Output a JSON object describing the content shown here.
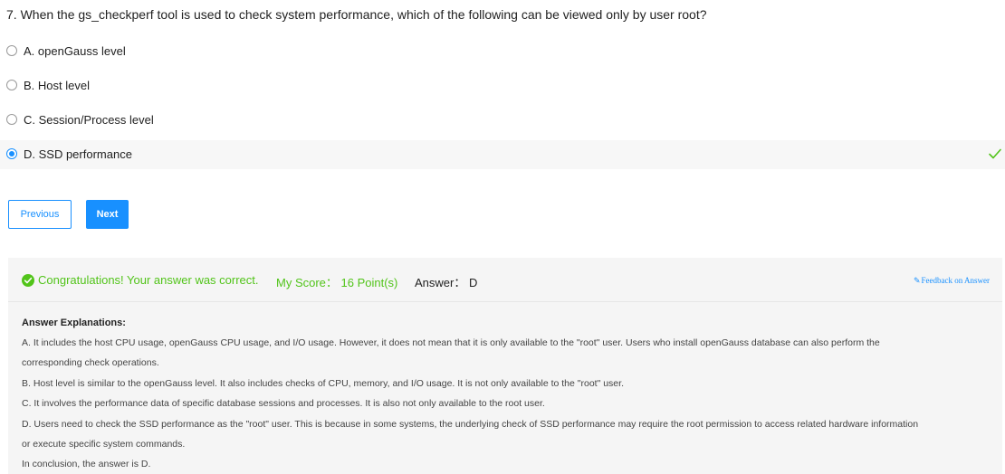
{
  "question": {
    "title": "7. When the gs_checkperf tool is used to check system performance, which of the following can be viewed only by user root?"
  },
  "options": [
    {
      "label": "A. openGauss level",
      "selected": false
    },
    {
      "label": "B. Host level",
      "selected": false
    },
    {
      "label": "C. Session/Process level",
      "selected": false
    },
    {
      "label": "D. SSD performance",
      "selected": true
    }
  ],
  "icons": {
    "correct_mark": "checkmark-icon",
    "success": "check-circle-icon",
    "feedback": "edit-icon"
  },
  "buttons": {
    "previous": "Previous",
    "next": "Next"
  },
  "result": {
    "congrats": "Congratulations! Your answer was correct.",
    "score": "My Score： 16 Point(s)",
    "answer": "Answer： D",
    "feedback": "Feedback on Answer"
  },
  "explanations": {
    "title": "Answer Explanations:",
    "lines": [
      "A. It includes the host CPU usage, openGauss CPU usage, and I/O usage. However, it does not mean that it is only available to the \"root\" user. Users who install openGauss database can also perform the",
      "corresponding check operations.",
      "B. Host level is similar to the openGauss level. It also includes checks of CPU, memory, and I/O usage. It is not only available to the \"root\" user.",
      "C. It involves the performance data of specific database sessions and processes. It is also not only available to the root user.",
      "D. Users need to check the SSD performance as the \"root\" user. This is because in some systems, the underlying check of SSD performance may require the root permission to access related hardware information",
      "or execute specific system commands.",
      "In conclusion, the answer is D."
    ]
  },
  "colors": {
    "primary": "#1890ff",
    "success": "#52c41a",
    "panel_bg": "#f5f5f5"
  }
}
